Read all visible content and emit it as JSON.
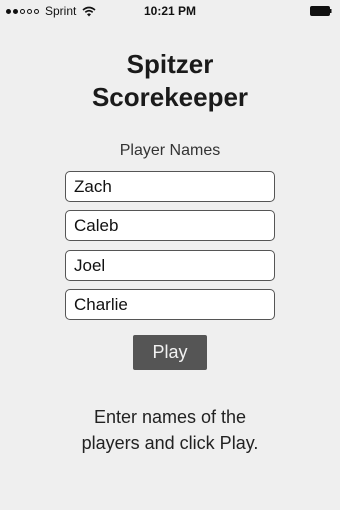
{
  "status_bar": {
    "carrier": "Sprint",
    "time": "10:21 PM",
    "signal_bars_filled": 2,
    "signal_bars_total": 5
  },
  "app": {
    "title_line1": "Spitzer",
    "title_line2": "Scorekeeper"
  },
  "players": {
    "label": "Player Names",
    "names": [
      "Zach",
      "Caleb",
      "Joel",
      "Charlie"
    ]
  },
  "play_button": {
    "label": "Play"
  },
  "instructions": {
    "line1": "Enter names of the",
    "line2": "players and click Play."
  },
  "icons": {
    "wifi": "wifi-icon",
    "battery": "battery-icon"
  },
  "colors": {
    "background": "#efefef",
    "button": "#555555",
    "button_text": "#f2f2f2"
  }
}
